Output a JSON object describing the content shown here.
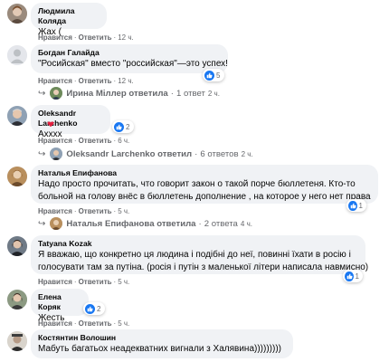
{
  "comments": [
    {
      "author": "Людмила Коляда",
      "text": "Жах (",
      "actions": {
        "like": "Нравится",
        "reply": "Ответить",
        "time": "12 ч."
      }
    },
    {
      "author": "Богдан Галайда",
      "text": "\"Росийская\" вместо \"российская\"—это успех!",
      "actions": {
        "like": "Нравится",
        "reply": "Ответить",
        "time": "12 ч."
      },
      "reaction_count": "5",
      "reply_summary": {
        "name": "Ирина Міллер ответила",
        "count": "1 ответ",
        "time": "2 ч."
      }
    },
    {
      "author": "Oleksandr Larchenko",
      "text": "Ахххх",
      "actions": {
        "like": "Нравится",
        "reply": "Ответить",
        "time": "6 ч."
      },
      "reaction_count": "2",
      "reply_summary": {
        "name": "Oleksandr Larchenko ответил",
        "count": "6 ответов",
        "time": "2 ч."
      }
    },
    {
      "author": "Наталья Епифанова",
      "text_lines": [
        "Надо просто прочитать, что говорит закон о такой порче бюллетеня. Кто-то",
        "больной на голову внёс в бюллетень дополнение , на которое у него нет права"
      ],
      "actions": {
        "like": "Нравится",
        "reply": "Ответить",
        "time": "5 ч."
      },
      "reaction_count": "1",
      "reply_summary": {
        "name": "Наталья Епифанова ответила",
        "count": "2 ответа",
        "time": "4 ч."
      }
    },
    {
      "author": "Tatyana Kozak",
      "text_lines": [
        "Я вважаю, що конкретно ця людина і подібні до неї, повинні їхати в росію і",
        "голосувати там за путіна. (росія і путін з маленької літери написала навмисно)"
      ],
      "actions": {
        "like": "Нравится",
        "reply": "Ответить",
        "time": "5 ч."
      },
      "reaction_count": "1"
    },
    {
      "author": "Елена Коряк",
      "text": "Жесть",
      "actions": {
        "like": "Нравится",
        "reply": "Ответить",
        "time": "5 ч."
      },
      "reaction_count": "2"
    },
    {
      "author": "Костянтин Волошин",
      "text": "Мабуть багатьох неадекватних вигнали з Халявина)))))))))"
    }
  ],
  "separator": "·",
  "colors": {
    "bubble": "#f0f2f5",
    "like_blue": "#1877f2",
    "meta": "#65676b"
  }
}
